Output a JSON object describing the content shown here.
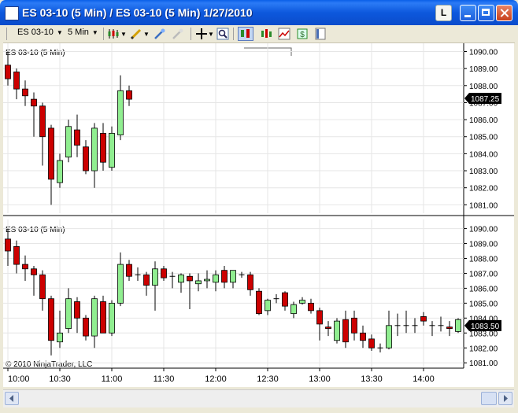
{
  "window": {
    "title": "ES 03-10 (5 Min) / ES 03-10 (5 Min)  1/27/2010",
    "l_button": "L"
  },
  "toolbar": {
    "instrument": "ES 03-10",
    "interval": "5 Min"
  },
  "colors": {
    "up": "#90EE90",
    "down": "#CC0000",
    "wick": "#000000"
  },
  "panel_top": {
    "label": "ES 03-10 (5 Min)",
    "last_price": "1087.25"
  },
  "panel_bottom": {
    "label": "ES 03-10 (5 Min)",
    "last_price": "1083.50",
    "copyright": "© 2010 NinjaTrader, LLC"
  },
  "chart_data": {
    "type": "candlestick",
    "time_labels": [
      "10:00",
      "10:30",
      "11:00",
      "11:30",
      "12:00",
      "12:30",
      "13:00",
      "13:30",
      "14:00"
    ],
    "panels": [
      {
        "y_ticks": [
          "1090.00",
          "1089.00",
          "1088.00",
          "1087.00",
          "1086.00",
          "1085.00",
          "1084.00",
          "1083.00",
          "1082.00",
          "1081.00"
        ],
        "ylim": [
          1080.6,
          1090.3
        ],
        "candles": [
          {
            "o": 1089.2,
            "h": 1090.0,
            "l": 1088.0,
            "c": 1088.4
          },
          {
            "o": 1088.8,
            "h": 1089.0,
            "l": 1087.2,
            "c": 1087.8
          },
          {
            "o": 1087.8,
            "h": 1088.3,
            "l": 1086.8,
            "c": 1087.4
          },
          {
            "o": 1087.2,
            "h": 1087.6,
            "l": 1085.0,
            "c": 1086.8
          },
          {
            "o": 1086.8,
            "h": 1087.0,
            "l": 1083.3,
            "c": 1085.0
          },
          {
            "o": 1085.5,
            "h": 1085.7,
            "l": 1081.0,
            "c": 1082.5
          },
          {
            "o": 1082.3,
            "h": 1084.0,
            "l": 1082.0,
            "c": 1083.6
          },
          {
            "o": 1083.8,
            "h": 1086.0,
            "l": 1083.5,
            "c": 1085.6
          },
          {
            "o": 1085.4,
            "h": 1086.3,
            "l": 1083.8,
            "c": 1084.5
          },
          {
            "o": 1084.4,
            "h": 1084.8,
            "l": 1082.8,
            "c": 1083.0
          },
          {
            "o": 1083.0,
            "h": 1085.8,
            "l": 1082.0,
            "c": 1085.5
          },
          {
            "o": 1085.2,
            "h": 1085.8,
            "l": 1083.0,
            "c": 1083.5
          },
          {
            "o": 1083.2,
            "h": 1085.6,
            "l": 1083.0,
            "c": 1085.2
          },
          {
            "o": 1085.1,
            "h": 1088.6,
            "l": 1084.8,
            "c": 1087.7
          },
          {
            "o": 1087.7,
            "h": 1088.0,
            "l": 1086.8,
            "c": 1087.2
          }
        ]
      },
      {
        "y_ticks": [
          "1090.00",
          "1089.00",
          "1088.00",
          "1087.00",
          "1086.00",
          "1085.00",
          "1084.00",
          "1083.00",
          "1082.00",
          "1081.00"
        ],
        "ylim": [
          1080.8,
          1090.4
        ],
        "candles": [
          {
            "o": 1089.3,
            "h": 1090.0,
            "l": 1087.5,
            "c": 1088.5
          },
          {
            "o": 1088.8,
            "h": 1089.2,
            "l": 1087.0,
            "c": 1087.6
          },
          {
            "o": 1087.6,
            "h": 1088.2,
            "l": 1086.5,
            "c": 1087.3
          },
          {
            "o": 1087.3,
            "h": 1087.5,
            "l": 1085.5,
            "c": 1086.9
          },
          {
            "o": 1086.9,
            "h": 1087.2,
            "l": 1084.5,
            "c": 1085.3
          },
          {
            "o": 1085.3,
            "h": 1085.5,
            "l": 1081.5,
            "c": 1082.5
          },
          {
            "o": 1082.4,
            "h": 1084.5,
            "l": 1082.0,
            "c": 1083.0
          },
          {
            "o": 1083.3,
            "h": 1086.0,
            "l": 1083.0,
            "c": 1085.3
          },
          {
            "o": 1085.1,
            "h": 1085.4,
            "l": 1083.0,
            "c": 1084.0
          },
          {
            "o": 1084.0,
            "h": 1084.2,
            "l": 1082.5,
            "c": 1082.8
          },
          {
            "o": 1082.8,
            "h": 1085.5,
            "l": 1082.0,
            "c": 1085.3
          },
          {
            "o": 1085.1,
            "h": 1085.5,
            "l": 1083.0,
            "c": 1083.0
          },
          {
            "o": 1083.0,
            "h": 1085.2,
            "l": 1082.8,
            "c": 1085.0
          },
          {
            "o": 1085.0,
            "h": 1088.4,
            "l": 1084.8,
            "c": 1087.6
          },
          {
            "o": 1087.6,
            "h": 1087.9,
            "l": 1086.5,
            "c": 1086.8
          },
          {
            "o": 1086.9,
            "h": 1087.4,
            "l": 1086.5,
            "c": 1086.9
          },
          {
            "o": 1086.9,
            "h": 1087.1,
            "l": 1085.5,
            "c": 1086.2
          },
          {
            "o": 1086.2,
            "h": 1087.8,
            "l": 1084.5,
            "c": 1087.3
          },
          {
            "o": 1087.3,
            "h": 1087.5,
            "l": 1086.5,
            "c": 1086.7
          },
          {
            "o": 1086.8,
            "h": 1087.1,
            "l": 1086.0,
            "c": 1086.8
          },
          {
            "o": 1086.4,
            "h": 1087.0,
            "l": 1085.7,
            "c": 1086.9
          },
          {
            "o": 1086.8,
            "h": 1087.0,
            "l": 1084.6,
            "c": 1086.5
          },
          {
            "o": 1086.3,
            "h": 1087.0,
            "l": 1085.8,
            "c": 1086.5
          },
          {
            "o": 1086.5,
            "h": 1087.2,
            "l": 1086.0,
            "c": 1086.6
          },
          {
            "o": 1086.4,
            "h": 1087.2,
            "l": 1085.8,
            "c": 1086.9
          },
          {
            "o": 1087.2,
            "h": 1087.5,
            "l": 1086.0,
            "c": 1086.4
          },
          {
            "o": 1086.4,
            "h": 1087.2,
            "l": 1086.0,
            "c": 1087.2
          },
          {
            "o": 1086.9,
            "h": 1087.1,
            "l": 1086.7,
            "c": 1086.9
          },
          {
            "o": 1086.9,
            "h": 1087.1,
            "l": 1085.5,
            "c": 1085.9
          },
          {
            "o": 1085.8,
            "h": 1086.0,
            "l": 1084.2,
            "c": 1084.3
          },
          {
            "o": 1084.5,
            "h": 1085.3,
            "l": 1084.2,
            "c": 1085.2
          },
          {
            "o": 1085.3,
            "h": 1085.6,
            "l": 1085.0,
            "c": 1085.3
          },
          {
            "o": 1085.7,
            "h": 1085.8,
            "l": 1084.5,
            "c": 1084.8
          },
          {
            "o": 1084.3,
            "h": 1085.1,
            "l": 1084.0,
            "c": 1084.9
          },
          {
            "o": 1085.0,
            "h": 1085.4,
            "l": 1084.9,
            "c": 1085.2
          },
          {
            "o": 1085.0,
            "h": 1085.3,
            "l": 1084.3,
            "c": 1084.5
          },
          {
            "o": 1084.5,
            "h": 1084.7,
            "l": 1082.5,
            "c": 1083.6
          },
          {
            "o": 1083.4,
            "h": 1083.8,
            "l": 1082.8,
            "c": 1083.3
          },
          {
            "o": 1082.5,
            "h": 1084.0,
            "l": 1082.3,
            "c": 1083.8
          },
          {
            "o": 1083.9,
            "h": 1084.5,
            "l": 1082.0,
            "c": 1082.4
          },
          {
            "o": 1084.0,
            "h": 1084.5,
            "l": 1082.5,
            "c": 1083.0
          },
          {
            "o": 1083.0,
            "h": 1083.5,
            "l": 1082.0,
            "c": 1082.5
          },
          {
            "o": 1082.6,
            "h": 1082.9,
            "l": 1081.8,
            "c": 1082.0
          },
          {
            "o": 1082.0,
            "h": 1082.3,
            "l": 1081.7,
            "c": 1082.0
          },
          {
            "o": 1082.0,
            "h": 1084.5,
            "l": 1081.9,
            "c": 1083.5
          },
          {
            "o": 1083.5,
            "h": 1084.3,
            "l": 1082.8,
            "c": 1083.5
          },
          {
            "o": 1083.5,
            "h": 1084.5,
            "l": 1083.0,
            "c": 1083.5
          },
          {
            "o": 1083.5,
            "h": 1084.0,
            "l": 1083.0,
            "c": 1083.5
          },
          {
            "o": 1084.1,
            "h": 1084.4,
            "l": 1083.5,
            "c": 1083.8
          },
          {
            "o": 1083.5,
            "h": 1083.8,
            "l": 1082.8,
            "c": 1083.5
          },
          {
            "o": 1083.5,
            "h": 1084.1,
            "l": 1083.1,
            "c": 1083.5
          },
          {
            "o": 1083.4,
            "h": 1083.8,
            "l": 1082.8,
            "c": 1083.3
          },
          {
            "o": 1083.1,
            "h": 1084.0,
            "l": 1083.0,
            "c": 1083.9
          }
        ]
      }
    ]
  }
}
